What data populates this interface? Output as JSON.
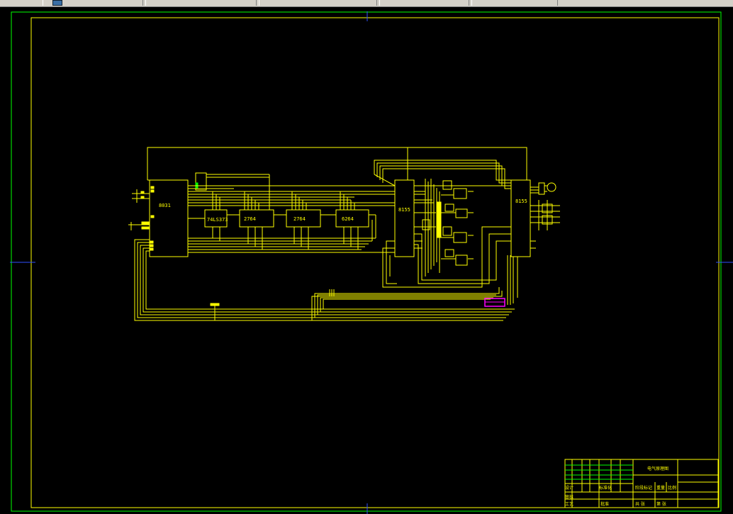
{
  "chips": {
    "mcu": "8031",
    "latch": "74LS373",
    "eprom1": "2764",
    "eprom2": "2764",
    "sram": "6264",
    "io1": "8155",
    "io2": "8155"
  },
  "title_block": {
    "drawing_title": "电气原理图",
    "designer_label": "设计",
    "reviewer_label": "审核",
    "process_label": "工艺",
    "standard_label": "标准化",
    "approve_label": "批准",
    "stage_label": "阶段标记",
    "weight_label": "重量",
    "scale_label": "比例",
    "sheet_total": "共 张",
    "sheet_no": "第 张"
  },
  "colors": {
    "background": "#000000",
    "wire": "#ffff00",
    "frame_inner": "#ffff00",
    "frame_outer": "#00ff00",
    "connector": "#ff00ff",
    "axis_marker": "#0000ff"
  }
}
